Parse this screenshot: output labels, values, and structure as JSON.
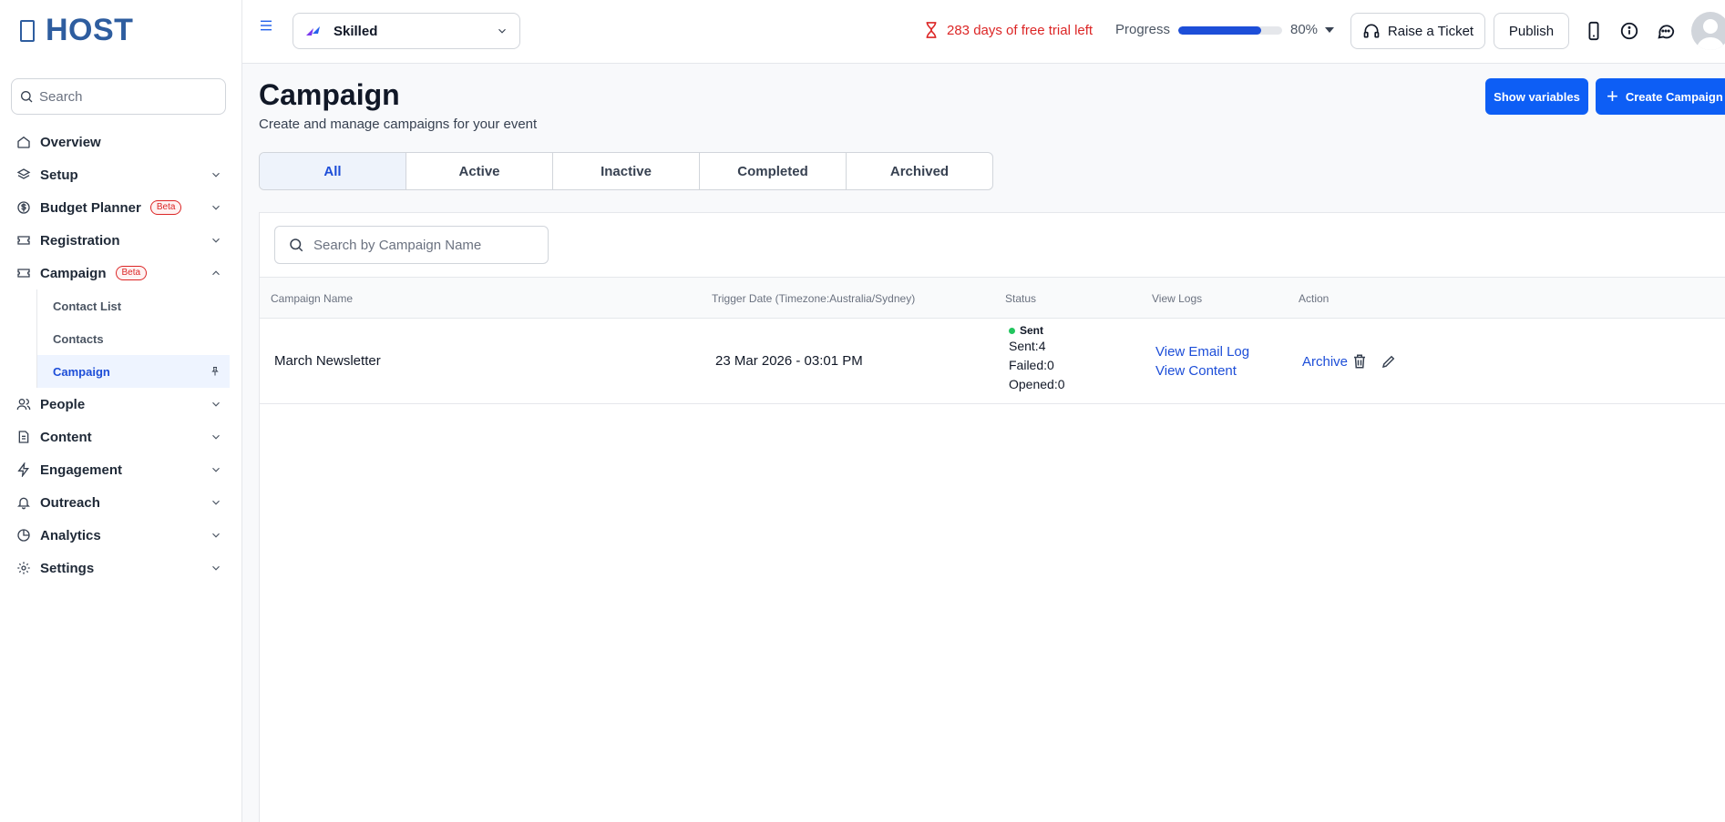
{
  "brand": {
    "name": "HOST"
  },
  "sidebar": {
    "search_placeholder": "Search",
    "items": [
      {
        "label": "Overview",
        "icon": "home-icon"
      },
      {
        "label": "Setup",
        "icon": "layers-icon"
      },
      {
        "label": "Budget Planner",
        "icon": "dollar-icon",
        "badge": "Beta"
      },
      {
        "label": "Registration",
        "icon": "ticket-icon"
      },
      {
        "label": "Campaign",
        "icon": "ticket-icon",
        "badge": "Beta",
        "expanded": true,
        "children": [
          {
            "label": "Contact List"
          },
          {
            "label": "Contacts"
          },
          {
            "label": "Campaign",
            "active": true,
            "icon": "pin-icon"
          }
        ]
      },
      {
        "label": "People",
        "icon": "users-icon"
      },
      {
        "label": "Content",
        "icon": "document-icon"
      },
      {
        "label": "Engagement",
        "icon": "lightning-icon"
      },
      {
        "label": "Outreach",
        "icon": "bell-icon"
      },
      {
        "label": "Analytics",
        "icon": "pie-chart-icon"
      },
      {
        "label": "Settings",
        "icon": "gear-icon"
      }
    ]
  },
  "topbar": {
    "event_name": "Skilled",
    "trial_text": "283 days of free trial left",
    "progress_label": "Progress",
    "progress_value": "80%",
    "progress_fraction": 0.8,
    "raise_ticket_label": "Raise a Ticket",
    "publish_label": "Publish",
    "icons": [
      "hamburger-menu-icon",
      "hourglass-icon",
      "headset-icon",
      "mobile-icon",
      "info-icon",
      "chat-icon",
      "avatar-icon"
    ]
  },
  "main": {
    "title": "Campaign",
    "subtitle": "Create and manage campaigns for your event",
    "show_variables_label": "Show variables",
    "create_campaign_label": "Create Campaign",
    "tabs": [
      {
        "label": "All",
        "active": true
      },
      {
        "label": "Active"
      },
      {
        "label": "Inactive"
      },
      {
        "label": "Completed"
      },
      {
        "label": "Archived"
      }
    ],
    "table": {
      "search_placeholder": "Search by Campaign Name",
      "columns": [
        "Campaign Name",
        "Trigger Date (Timezone:Australia/Sydney)",
        "Status",
        "View Logs",
        "Action"
      ],
      "rows": [
        {
          "name": "March Newsletter",
          "trigger_date": "23 Mar 2026 - 03:01 PM",
          "status": "Sent",
          "sent": "Sent:4",
          "failed": "Failed:0",
          "opened": "Opened:0",
          "view_email_log": "View Email Log",
          "view_content": "View Content",
          "archive": "Archive"
        }
      ]
    }
  },
  "colors": {
    "brand": "#2e5d9f",
    "primary": "#0d5ef5",
    "danger": "#dc2626",
    "success": "#22c55e"
  }
}
